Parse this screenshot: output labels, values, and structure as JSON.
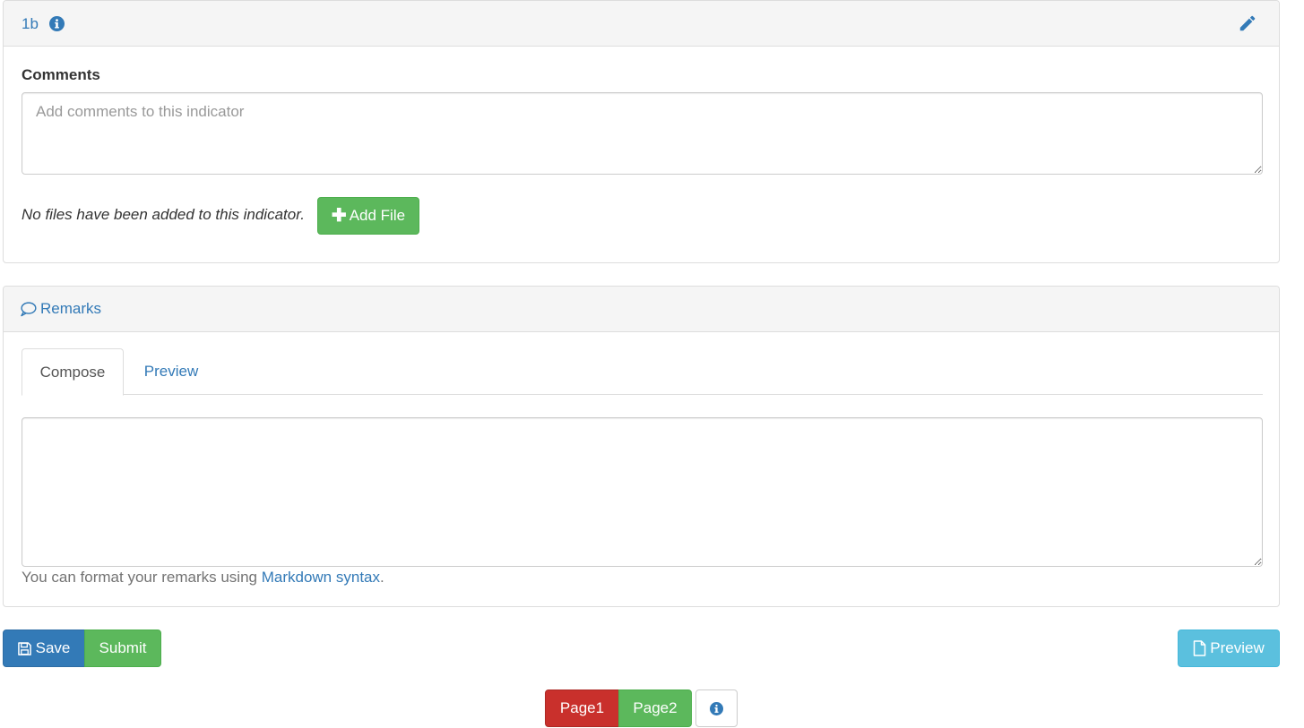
{
  "indicator": {
    "title": "1b",
    "comments_label": "Comments",
    "comments_placeholder": "Add comments to this indicator",
    "no_files_text": "No files have been added to this indicator.",
    "add_file_label": "Add File"
  },
  "remarks": {
    "title": "Remarks",
    "tabs": [
      {
        "label": "Compose",
        "active": true
      },
      {
        "label": "Preview",
        "active": false
      }
    ],
    "help_prefix": "You can format your remarks using ",
    "help_link": "Markdown syntax",
    "help_suffix": "."
  },
  "actions": {
    "save_label": "Save",
    "submit_label": "Submit",
    "preview_label": "Preview"
  },
  "pagination": {
    "pages": [
      "Page1",
      "Page2"
    ]
  },
  "colors": {
    "link": "#337ab7",
    "success": "#5cb85c",
    "primary": "#337ab7",
    "info": "#5bc0de",
    "danger": "#c9302c"
  },
  "icons": {
    "indicator_info": "info-circle-icon",
    "edit": "pencil-icon",
    "remarks": "speech-bubble-icon",
    "add_file": "plus-icon",
    "save": "floppy-disk-icon",
    "preview": "file-icon",
    "page_info": "info-circle-icon"
  }
}
